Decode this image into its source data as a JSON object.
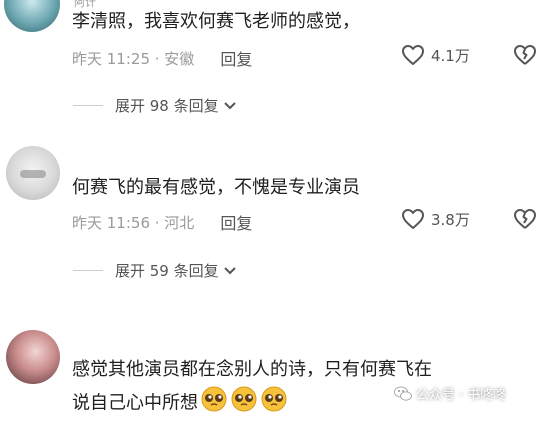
{
  "comments": [
    {
      "text": "李清照，我喜欢何赛飞老师的感觉，",
      "time": "昨天 11:25 · 安徽",
      "reply_label": "回复",
      "likes": "4.1万",
      "expand_label": "展开 98 条回复"
    },
    {
      "text": "何赛飞的最有感觉，不愧是专业演员",
      "time": "昨天 11:56 · 河北",
      "reply_label": "回复",
      "likes": "3.8万",
      "expand_label": "展开 59 条回复"
    },
    {
      "text_line1": "感觉其他演员都在念别人的诗，只有何赛飞在",
      "text_line2": "说自己心中所想",
      "emoji": [
        "pleading-face-emoji",
        "pleading-face-emoji",
        "pleading-face-emoji"
      ]
    }
  ],
  "watermark": "公众号 · 书咚咚",
  "icons": {
    "like": "heart-outline-icon",
    "dislike": "broken-heart-icon",
    "expand": "chevron-down-icon",
    "watermark": "wechat-icon"
  },
  "colors": {
    "text": "#1f1f1f",
    "meta": "#9a9a9a",
    "secondary": "#555555"
  }
}
